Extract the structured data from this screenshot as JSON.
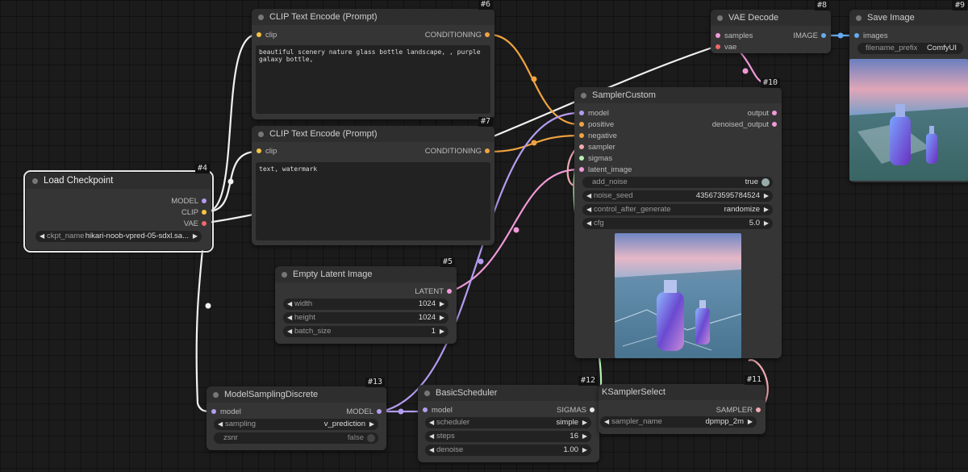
{
  "nodes": {
    "n6": {
      "id": "#6",
      "title": "CLIP Text Encode (Prompt)",
      "input": "clip",
      "output": "CONDITIONING",
      "text": "beautiful scenery nature glass bottle landscape, , purple galaxy bottle,"
    },
    "n7": {
      "id": "#7",
      "title": "CLIP Text Encode (Prompt)",
      "input": "clip",
      "output": "CONDITIONING",
      "text": "text, watermark"
    },
    "n4": {
      "id": "#4",
      "title": "Load Checkpoint",
      "outputs": [
        "MODEL",
        "CLIP",
        "VAE"
      ],
      "widget": {
        "label": "ckpt_name",
        "value": "hikari-noob-vpred-05-sdxl.sa..."
      }
    },
    "n5": {
      "id": "#5",
      "title": "Empty Latent Image",
      "output": "LATENT",
      "widgets": [
        {
          "label": "width",
          "value": "1024"
        },
        {
          "label": "height",
          "value": "1024"
        },
        {
          "label": "batch_size",
          "value": "1"
        }
      ]
    },
    "n8": {
      "id": "#8",
      "title": "VAE Decode",
      "inputs": [
        "samples",
        "vae"
      ],
      "output": "IMAGE"
    },
    "n9": {
      "id": "#9",
      "title": "Save Image",
      "input": "images",
      "widget": {
        "label": "filename_prefix",
        "value": "ComfyUI"
      }
    },
    "n10": {
      "id": "#10",
      "title": "SamplerCustom",
      "inputs": [
        "model",
        "positive",
        "negative",
        "sampler",
        "sigmas",
        "latent_image"
      ],
      "outputs": [
        "output",
        "denoised_output"
      ],
      "widgets": [
        {
          "label": "add_noise",
          "value": "true"
        },
        {
          "label": "noise_seed",
          "value": "435673595784524"
        },
        {
          "label": "control_after_generate",
          "value": "randomize"
        },
        {
          "label": "cfg",
          "value": "5.0"
        }
      ]
    },
    "n13": {
      "id": "#13",
      "title": "ModelSamplingDiscrete",
      "input": "model",
      "output": "MODEL",
      "widgets": [
        {
          "label": "sampling",
          "value": "v_prediction"
        },
        {
          "label": "zsnr",
          "value": "false"
        }
      ]
    },
    "n12": {
      "id": "#12",
      "title": "BasicScheduler",
      "input": "model",
      "output": "SIGMAS",
      "widgets": [
        {
          "label": "scheduler",
          "value": "simple"
        },
        {
          "label": "steps",
          "value": "16"
        },
        {
          "label": "denoise",
          "value": "1.00"
        }
      ]
    },
    "n11": {
      "id": "#11",
      "title": "KSamplerSelect",
      "output": "SAMPLER",
      "widget": {
        "label": "sampler_name",
        "value": "dpmpp_2m"
      }
    }
  },
  "colors": {
    "canvas": "#1b1b1b",
    "node": "#353535",
    "clip": "#f5c542",
    "conditioning": "#f0a341",
    "model": "#b49cf0",
    "latent": "#f09ad8",
    "vae": "#f0666b",
    "image": "#66aaf0",
    "sigmas": "#e8e8e8",
    "sampler": "#f0aab0"
  }
}
